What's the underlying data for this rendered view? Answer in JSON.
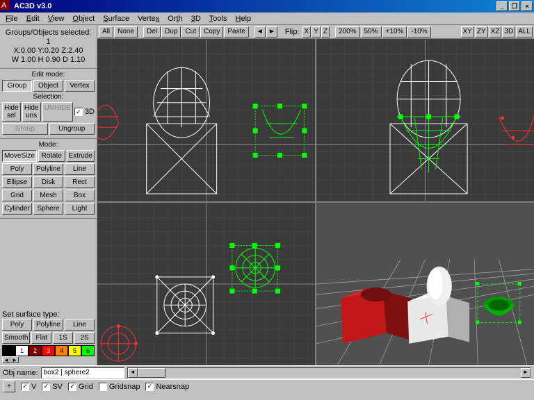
{
  "title": "AC3D v3.0",
  "menu": [
    "File",
    "Edit",
    "View",
    "Object",
    "Surface",
    "Vertex",
    "Orth",
    "3D",
    "Tools",
    "Help"
  ],
  "status": {
    "selection": "Groups/Objects selected: 1",
    "coords": "X:0.00 Y:0.20 Z:2.40",
    "dims": "W 1.00 H 0.90 D 1.10"
  },
  "editmode": {
    "label": "Edit mode:",
    "buttons": [
      "Group",
      "Object",
      "Vertex"
    ]
  },
  "selection": {
    "label": "Selection:",
    "hide_sel": "Hide sel",
    "hide_uns": "Hide uns",
    "unhide": "UNHIDE",
    "threed": "3D",
    "group": "Group",
    "ungroup": "Ungroup"
  },
  "mode": {
    "label": "Mode:",
    "rows": [
      [
        "MoveSize",
        "Rotate",
        "Extrude"
      ],
      [
        "Poly",
        "Polyline",
        "Line"
      ],
      [
        "Ellipse",
        "Disk",
        "Rect"
      ],
      [
        "Grid",
        "Mesh",
        "Box"
      ],
      [
        "Cylinder",
        "Sphere",
        "Light"
      ]
    ]
  },
  "toolbar": {
    "sel": [
      "All",
      "None"
    ],
    "edit": [
      "Del",
      "Dup",
      "Cut",
      "Copy",
      "Paste"
    ],
    "flip_label": "Flip:",
    "flip": [
      "X",
      "Y",
      "Z"
    ],
    "zoom": [
      "200%",
      "50%",
      "+10%",
      "-10%"
    ],
    "views": [
      "XY",
      "ZY",
      "XZ",
      "3D",
      "ALL"
    ]
  },
  "surface": {
    "label": "Set surface type:",
    "types": [
      "Poly",
      "Polyline",
      "Line"
    ],
    "shade": [
      "Smooth",
      "Flat",
      "1S",
      "2S"
    ],
    "colors": [
      {
        "n": "",
        "bg": "#000000",
        "fg": "#fff"
      },
      {
        "n": "1",
        "bg": "#ffffff",
        "fg": "#000"
      },
      {
        "n": "2",
        "bg": "#800000",
        "fg": "#fff"
      },
      {
        "n": "3",
        "bg": "#ff0000",
        "fg": "#fff"
      },
      {
        "n": "4",
        "bg": "#ff8000",
        "fg": "#000"
      },
      {
        "n": "5",
        "bg": "#ffff00",
        "fg": "#000"
      },
      {
        "n": "6",
        "bg": "#00ff00",
        "fg": "#000"
      }
    ]
  },
  "objname": {
    "label": "Obj name:",
    "value": "box2 | sphere2"
  },
  "bottombar": {
    "plus": "+",
    "v": "V",
    "sv": "SV",
    "grid": "Grid",
    "gridsnap": "Gridsnap",
    "nearsnap": "Nearsnap"
  }
}
